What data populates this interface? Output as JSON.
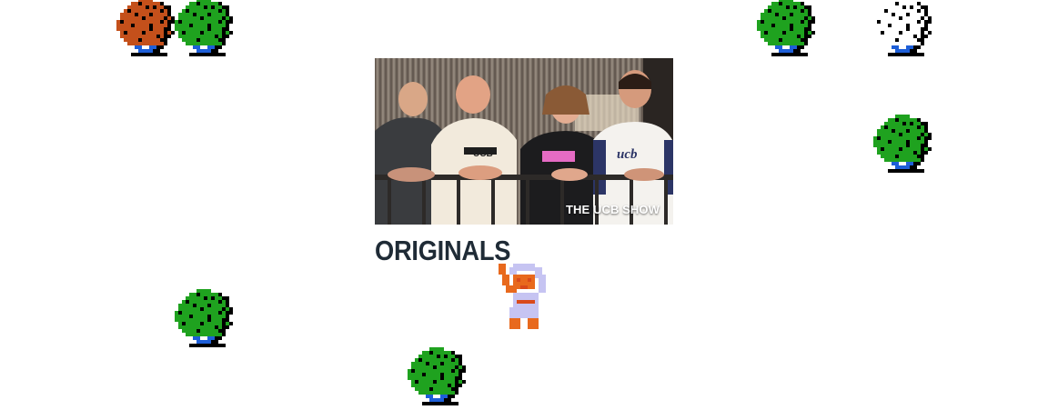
{
  "originals": {
    "heading": "ORIGINALS",
    "featured_show": {
      "caption": "THE UCB SHOW",
      "tshirt_text": "UCB"
    }
  },
  "sprites": {
    "trees": [
      {
        "icon": "pixel-tree-icon",
        "color": "#c4501b"
      },
      {
        "icon": "pixel-tree-icon",
        "color": "#1fa21f"
      },
      {
        "icon": "pixel-tree-icon",
        "color": "#1fa21f"
      },
      {
        "icon": "pixel-tree-icon",
        "color": "#ffffff"
      },
      {
        "icon": "pixel-tree-icon",
        "color": "#1fa21f"
      },
      {
        "icon": "pixel-tree-icon",
        "color": "#1fa21f"
      },
      {
        "icon": "pixel-tree-icon",
        "color": "#1fa21f"
      }
    ],
    "hero": {
      "icon": "pixel-hero-icon"
    }
  },
  "colors": {
    "heading": "#1f2b36",
    "tree_green": "#1fa21f",
    "tree_orange": "#c4501b",
    "tree_shadow": "#000000",
    "trunk_blue": "#1e5fd8"
  }
}
